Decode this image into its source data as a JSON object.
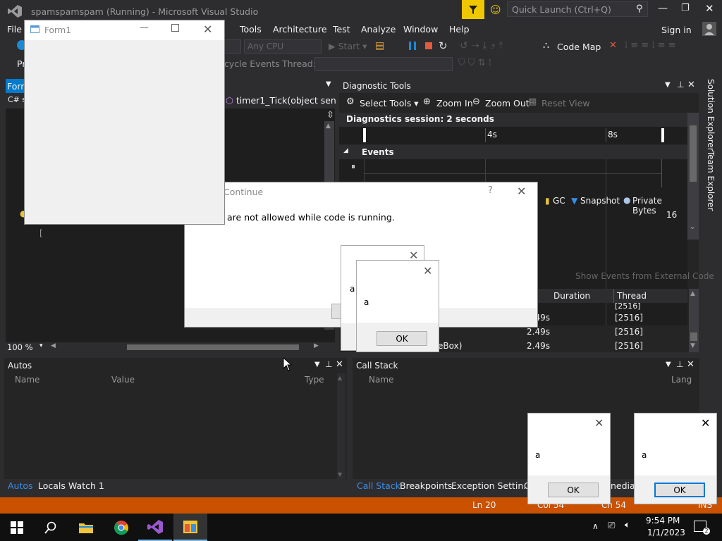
{
  "window": {
    "title": "spamspamspam (Running) - Microsoft Visual Studio",
    "quick_launch_placeholder": "Quick Launch (Ctrl+Q)"
  },
  "menu": {
    "file": "File",
    "tools": "Tools",
    "architecture": "Architecture",
    "test": "Test",
    "analyze": "Analyze",
    "window": "Window",
    "help": "Help",
    "sign_in": "Sign in"
  },
  "toolbar": {
    "platform": "Any CPU",
    "start": "Start",
    "code_map": "Code Map",
    "lifecycle": "cycle Events",
    "thread_label": "Thread:"
  },
  "editor": {
    "tab": "Form",
    "file_tab": "C# s",
    "method_dropdown": "timer1_Tick(object sen",
    "zoom": "100 %"
  },
  "form1": {
    "title": "Form1"
  },
  "continue_dialog": {
    "title": "Continue",
    "help": "?",
    "message": "are not allowed while code is running."
  },
  "diagnostics": {
    "title": "Diagnostic Tools",
    "select_tools": "Select Tools",
    "zoom_in": "Zoom In",
    "zoom_out": "Zoom Out",
    "reset_view": "Reset View",
    "session": "Diagnostics session: 2 seconds",
    "tick_4s": "4s",
    "tick_8s": "8s",
    "events": "Events",
    "gc": "GC",
    "snapshot": "Snapshot",
    "private_bytes": "Private Bytes",
    "value_16": "16",
    "show_external": "Show Events from External Code",
    "col_duration": "Duration",
    "col_thread": "Thread",
    "rows": [
      {
        "name": "",
        "duration": "2.49s",
        "thread": "[2516]"
      },
      {
        "name": "",
        "duration": "2.49s",
        "thread": "[2516]"
      },
      {
        "name": "eBox)",
        "duration": "2.49s",
        "thread": "[2516]"
      }
    ],
    "row_top_thread": "[2516]"
  },
  "autos": {
    "title": "Autos",
    "col_name": "Name",
    "col_value": "Value",
    "col_type": "Type",
    "tabs": [
      "Autos",
      "Locals",
      "Watch 1"
    ]
  },
  "callstack": {
    "title": "Call Stack",
    "col_name": "Name",
    "col_lang": "Lang",
    "tabs": [
      "Call Stack",
      "Breakpoints",
      "Exception Settin...",
      "C",
      "nediat"
    ]
  },
  "sidebar": {
    "solution_explorer": "Solution Explorer",
    "team_explorer": "Team Explorer"
  },
  "status": {
    "ln": "Ln 20",
    "col": "Col 54",
    "ch": "Ch 54",
    "ins": "INS"
  },
  "msgboxes": [
    {
      "text": "a",
      "ok": "OK"
    },
    {
      "text": "a",
      "ok": "OK"
    },
    {
      "text": "a",
      "ok": "OK"
    },
    {
      "text": "a",
      "ok": "OK"
    }
  ],
  "clock": {
    "time": "9:54 PM",
    "date": "1/1/2023"
  },
  "colors": {
    "accent": "#007acc",
    "status": "#ca5100",
    "vs_purple": "#68217a"
  }
}
